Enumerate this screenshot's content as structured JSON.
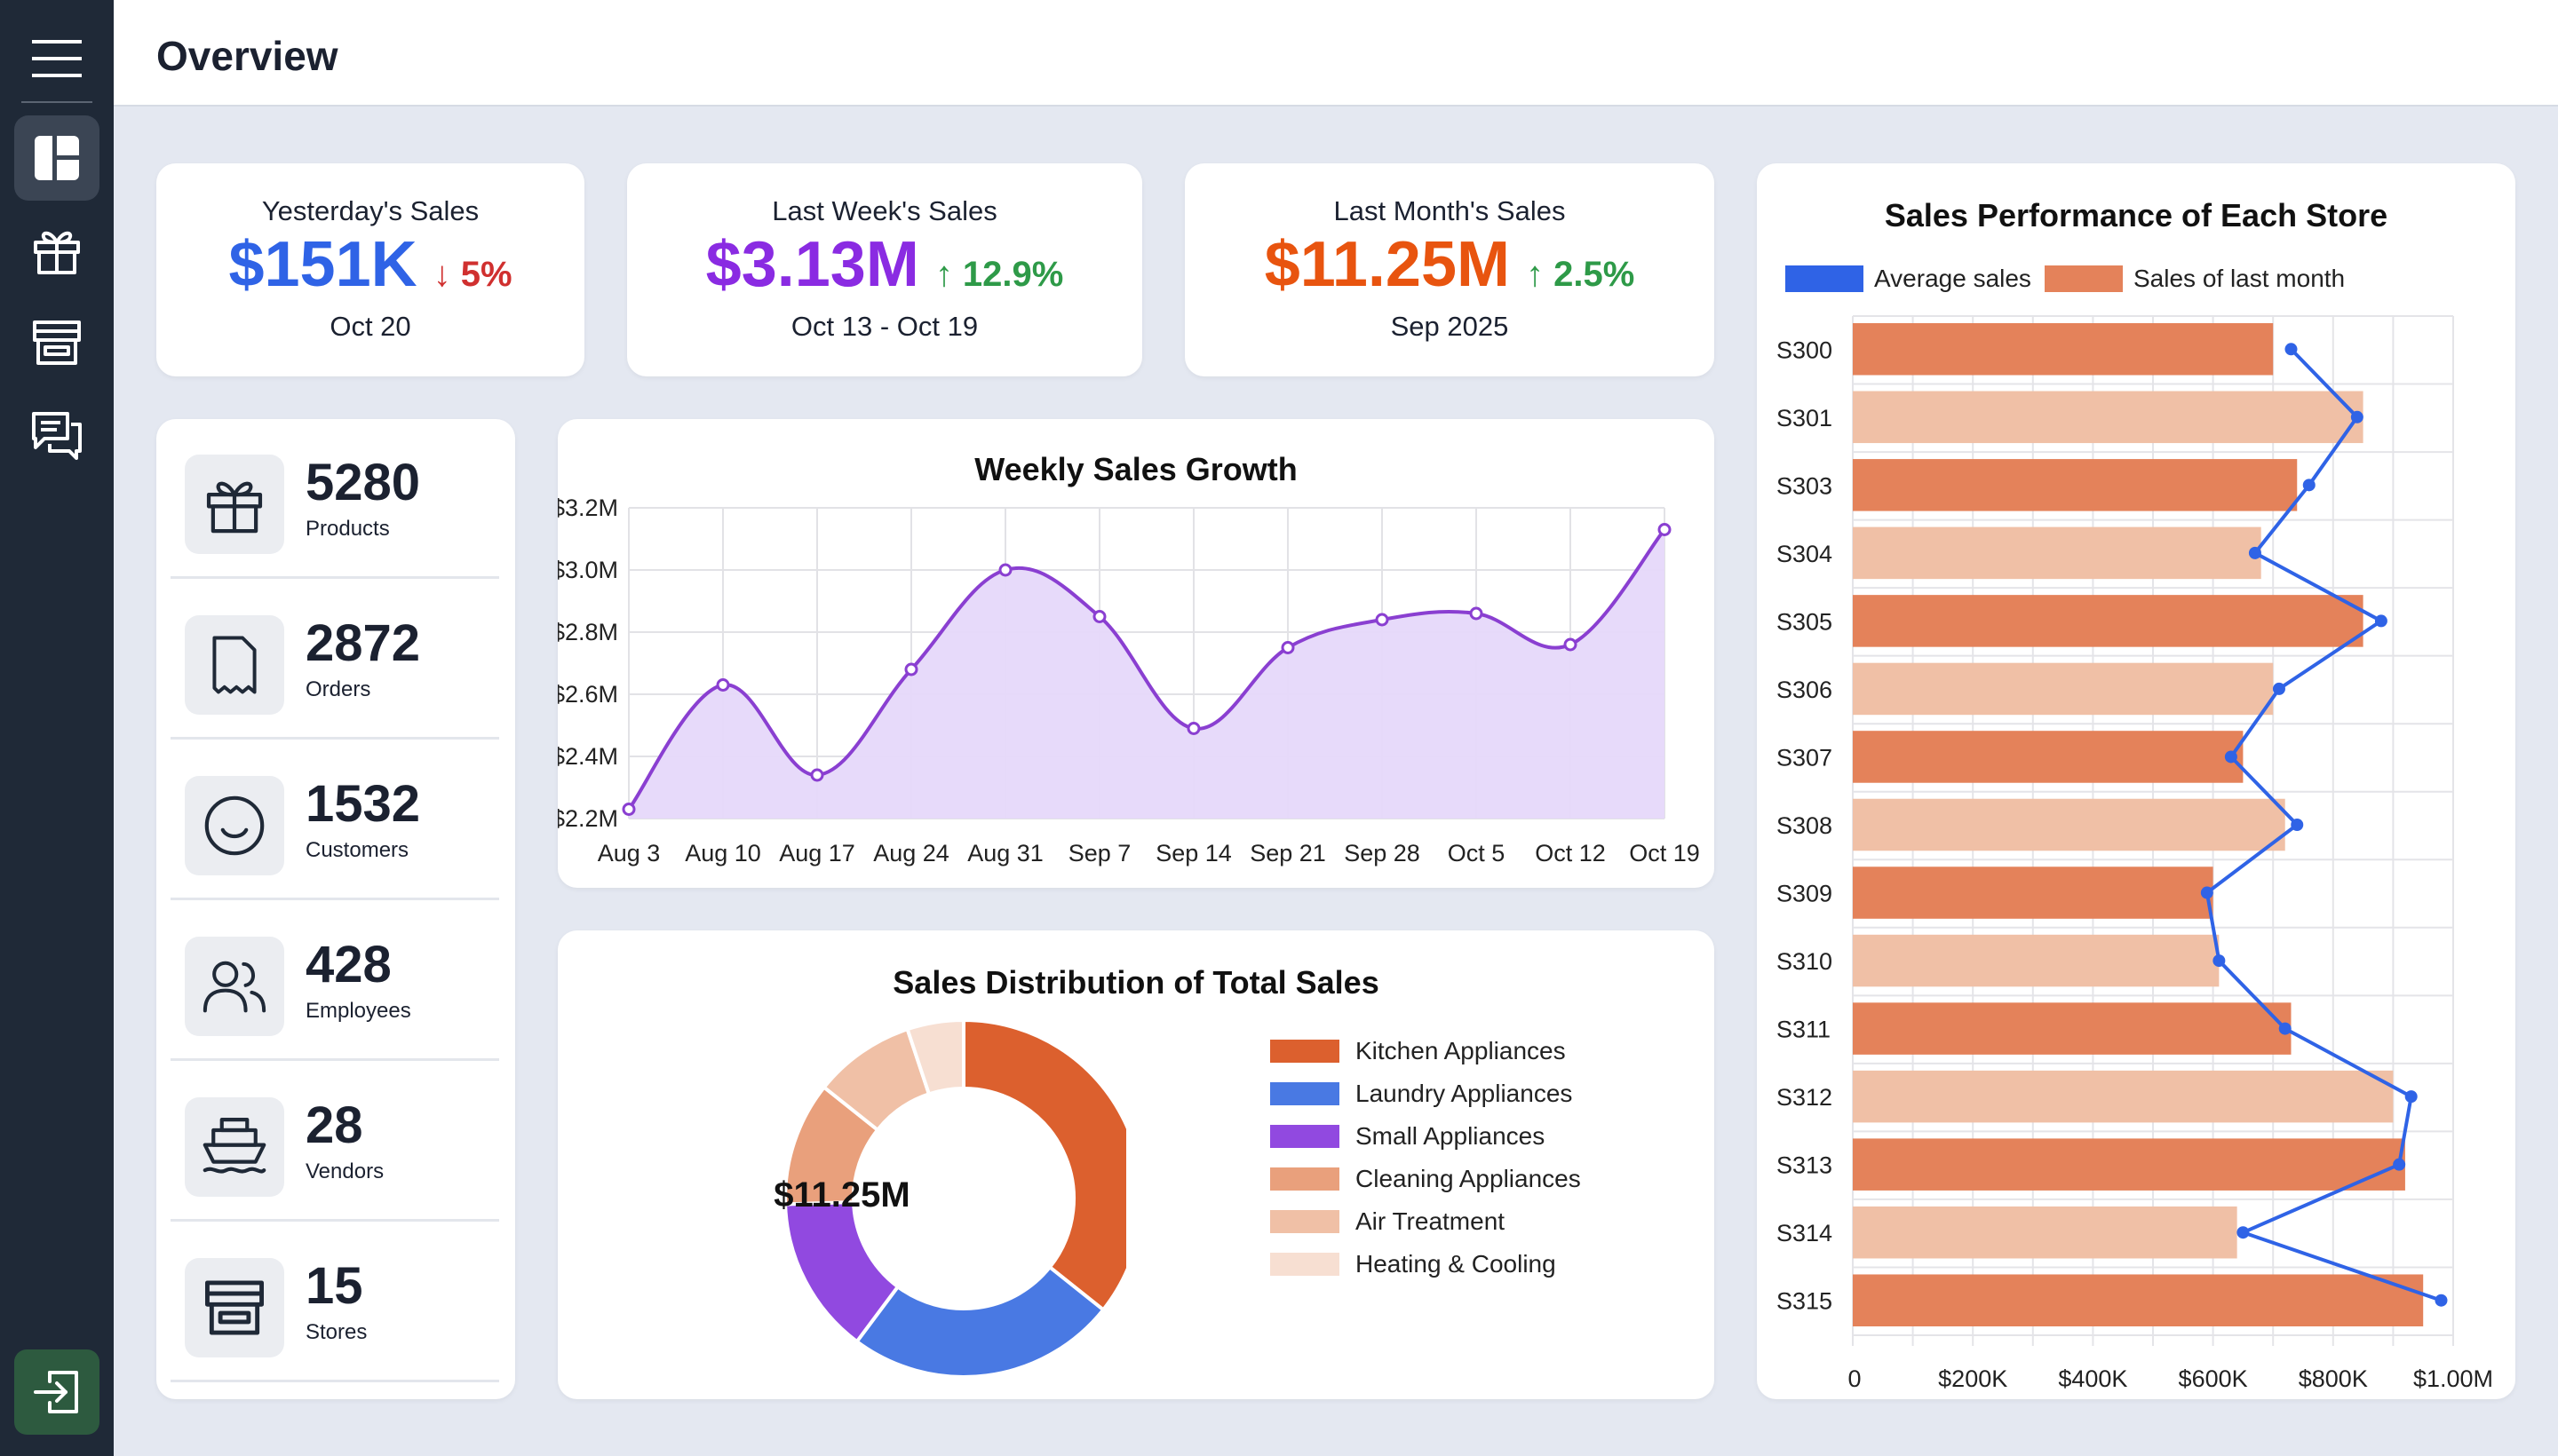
{
  "header": {
    "title": "Overview"
  },
  "sidebar": {
    "items": [
      {
        "name": "dashboard",
        "icon": "dashboard-icon",
        "active": true
      },
      {
        "name": "products",
        "icon": "gift-icon",
        "active": false
      },
      {
        "name": "stores",
        "icon": "store-icon",
        "active": false
      },
      {
        "name": "messages",
        "icon": "chat-icon",
        "active": false
      }
    ],
    "logout_icon": "logout-icon"
  },
  "kpis": [
    {
      "label": "Yesterday's Sales",
      "value": "$151K",
      "delta": "↓ 5%",
      "period": "Oct 20",
      "value_color": "#2f63e6",
      "delta_color": "#d0302f"
    },
    {
      "label": "Last Week's Sales",
      "value": "$3.13M",
      "delta": "↑ 12.9%",
      "period": "Oct 13 - Oct 19",
      "value_color": "#8a2be2",
      "delta_color": "#2e9a48"
    },
    {
      "label": "Last Month's Sales",
      "value": "$11.25M",
      "delta": "↑ 2.5%",
      "period": "Sep 2025",
      "value_color": "#e8540f",
      "delta_color": "#2e9a48"
    }
  ],
  "stats": [
    {
      "number": "5280",
      "label": "Products",
      "icon": "gift-icon"
    },
    {
      "number": "2872",
      "label": "Orders",
      "icon": "receipt-icon"
    },
    {
      "number": "1532",
      "label": "Customers",
      "icon": "smiley-icon"
    },
    {
      "number": "428",
      "label": "Employees",
      "icon": "users-icon"
    },
    {
      "number": "28",
      "label": "Vendors",
      "icon": "ship-icon"
    },
    {
      "number": "15",
      "label": "Stores",
      "icon": "store-icon"
    }
  ],
  "chart_data": [
    {
      "type": "area",
      "title": "Weekly Sales Growth",
      "x": [
        "Aug 3",
        "Aug 10",
        "Aug 17",
        "Aug 24",
        "Aug 31",
        "Sep 7",
        "Sep 14",
        "Sep 21",
        "Sep 28",
        "Oct 5",
        "Oct 12",
        "Oct 19"
      ],
      "values": [
        2.23,
        2.63,
        2.34,
        2.68,
        3.0,
        2.85,
        2.49,
        2.75,
        2.84,
        2.86,
        2.76,
        3.13
      ],
      "unit": "$M",
      "ylim": [
        2.2,
        3.2
      ],
      "yticks": [
        "$2.2M",
        "$2.4M",
        "$2.6M",
        "$2.8M",
        "$3.0M",
        "$3.2M"
      ],
      "grid": true,
      "line_color": "#8a3fd1",
      "fill_color": "#e6d8fa"
    },
    {
      "type": "pie",
      "title": "Sales Distribution of Total Sales",
      "center_label": "$11.25M",
      "categories": [
        "Kitchen Appliances",
        "Laundry Appliances",
        "Small Appliances",
        "Cleaning Appliances",
        "Air Treatment",
        "Heating & Cooling"
      ],
      "values": [
        35,
        24,
        14,
        11,
        9,
        5
      ],
      "colors": [
        "#dc602e",
        "#4979e3",
        "#9149e0",
        "#e9a07c",
        "#f0c0a6",
        "#f7dfd2"
      ],
      "legend": "right"
    },
    {
      "type": "bar",
      "orientation": "horizontal",
      "title": "Sales Performance of Each Store",
      "categories": [
        "S300",
        "S301",
        "S303",
        "S304",
        "S305",
        "S306",
        "S307",
        "S308",
        "S309",
        "S310",
        "S311",
        "S312",
        "S313",
        "S314",
        "S315"
      ],
      "series": [
        {
          "name": "Sales of last month",
          "kind": "bar",
          "values": [
            700000,
            850000,
            740000,
            680000,
            850000,
            700000,
            650000,
            720000,
            600000,
            610000,
            730000,
            900000,
            920000,
            640000,
            950000
          ]
        },
        {
          "name": "Average sales",
          "kind": "line",
          "values": [
            730000,
            840000,
            760000,
            670000,
            880000,
            710000,
            630000,
            740000,
            590000,
            610000,
            720000,
            930000,
            910000,
            650000,
            980000
          ]
        }
      ],
      "xlim": [
        0,
        1000000
      ],
      "xticks": [
        "0",
        "$200K",
        "$400K",
        "$600K",
        "$800K",
        "$1.00M"
      ],
      "bar_colors": [
        "#e4825a",
        "#f0c0a6"
      ],
      "line_color": "#2f63e6",
      "legend": "top-left"
    }
  ]
}
